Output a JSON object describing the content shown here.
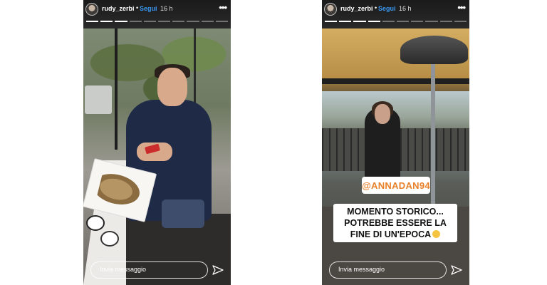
{
  "stories": [
    {
      "username": "rudy_zerbi",
      "separator": "•",
      "follow_label": "Segui",
      "time": "16 h",
      "more_label": "•••",
      "progress": [
        1,
        1,
        1,
        0,
        0,
        0,
        0,
        0,
        0,
        0
      ],
      "reply_placeholder": "Invia messaggio",
      "icons": {
        "avatar": "profile-avatar",
        "more": "more-icon",
        "send": "send-icon"
      }
    },
    {
      "username": "rudy_zerbi",
      "separator": "•",
      "follow_label": "Segui",
      "time": "16 h",
      "more_label": "•••",
      "progress": [
        1,
        1,
        1,
        1,
        0,
        0,
        0,
        0,
        0,
        0
      ],
      "reply_placeholder": "Invia messaggio",
      "mention_sticker": "@ANNADAN94",
      "caption_lines": [
        "MOMENTO STORICO...",
        "POTREBBE ESSERE LA",
        "FINE DI UN'EPOCA"
      ],
      "icons": {
        "avatar": "profile-avatar",
        "more": "more-icon",
        "send": "send-icon",
        "caption_emoji": "grinning-sweat-emoji"
      }
    }
  ],
  "colors": {
    "follow": "#3897f0",
    "mention": "#e8812b"
  }
}
